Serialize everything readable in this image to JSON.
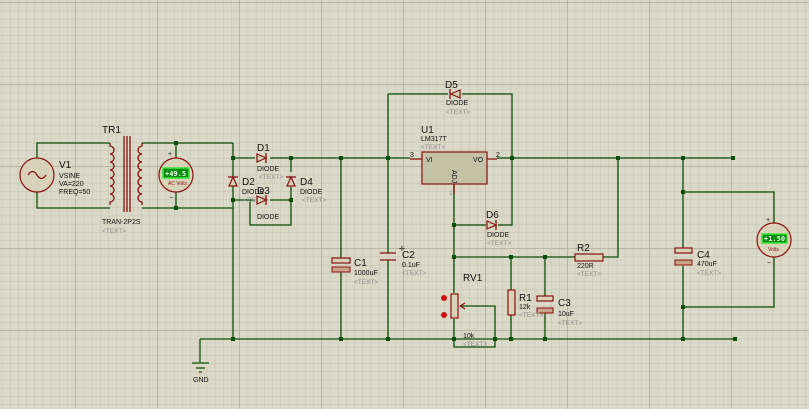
{
  "app": "Proteus ISIS schematic",
  "colors": {
    "background": "#dad9c7",
    "wire": "#0b4d0b",
    "component": "#8a1010",
    "lcd": "#0a8a0a"
  },
  "placeholder_text": "<TEXT>",
  "components": {
    "V1": {
      "ref": "V1",
      "type": "VSINE",
      "va": "VA=220",
      "freq": "FREQ=50"
    },
    "TR1": {
      "ref": "TR1",
      "value": "TRAN-2P2S"
    },
    "ac_meter": {
      "reading": "+49.5",
      "unit": "AC Volts"
    },
    "D1": {
      "ref": "D1",
      "value": "DIODE"
    },
    "D2": {
      "ref": "D2",
      "value": "DIODE"
    },
    "D3": {
      "ref": "D3",
      "value": "DIODE"
    },
    "D4": {
      "ref": "D4",
      "value": "DIODE"
    },
    "D5": {
      "ref": "D5",
      "value": "DIODE"
    },
    "D6": {
      "ref": "D6",
      "value": "DIODE"
    },
    "U1": {
      "ref": "U1",
      "value": "LM317T",
      "pin_in": "3",
      "pin_out": "2",
      "label_in": "VI",
      "label_out": "VO",
      "label_adj": "ADJ",
      "pin_adj": "1"
    },
    "C1": {
      "ref": "C1",
      "value": "1000uF"
    },
    "C2": {
      "ref": "C2",
      "value": "0.1uF"
    },
    "C3": {
      "ref": "C3",
      "value": "10uF"
    },
    "C4": {
      "ref": "C4",
      "value": "470uF"
    },
    "R1": {
      "ref": "R1",
      "value": "12k"
    },
    "R2": {
      "ref": "R2",
      "value": "220R"
    },
    "RV1": {
      "ref": "RV1",
      "value": "10k"
    },
    "dc_meter": {
      "reading": "+1.50",
      "unit": "Volts"
    },
    "GND": {
      "label": "GND"
    }
  }
}
